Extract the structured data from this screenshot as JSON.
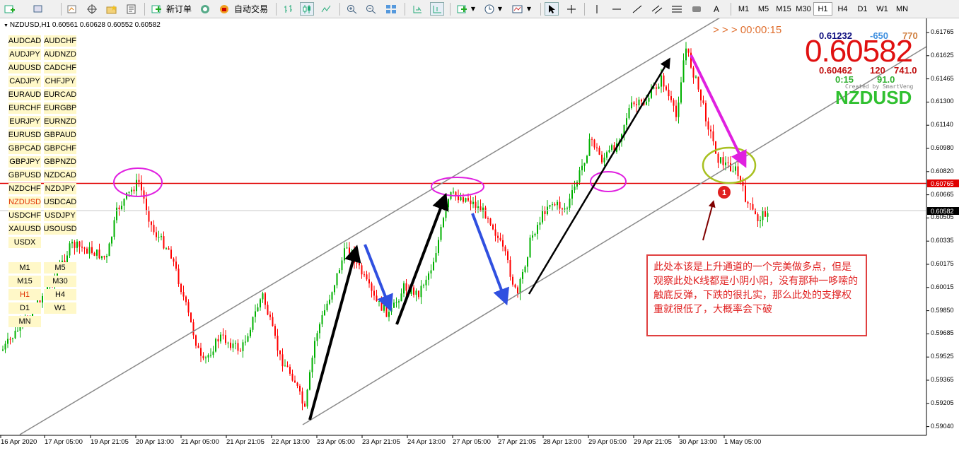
{
  "toolbar": {
    "new_order_label": "新订单",
    "auto_trade_label": "自动交易",
    "timeframes": [
      "M1",
      "M5",
      "M15",
      "M30",
      "H1",
      "H4",
      "D1",
      "W1",
      "MN"
    ],
    "active_timeframe": "H1",
    "text_tool_label": "A"
  },
  "chart": {
    "info_line": "NZDUSD,H1  0.60561 0.60628 0.60552 0.60582",
    "symbol_buttons": [
      "AUDCAD",
      "AUDCHF",
      "AUDJPY",
      "AUDNZD",
      "AUDUSD",
      "CADCHF",
      "CADJPY",
      "CHFJPY",
      "EURAUD",
      "EURCAD",
      "EURCHF",
      "EURGBP",
      "EURJPY",
      "EURNZD",
      "EURUSD",
      "GBPAUD",
      "GBPCAD",
      "GBPCHF",
      "GBPJPY",
      "GBPNZD",
      "GBPUSD",
      "NZDCAD",
      "NZDCHF",
      "NZDJPY",
      "NZDUSD",
      "USDCAD",
      "USDCHF",
      "USDJPY",
      "XAUUSD",
      "USOUSD",
      "USDX"
    ],
    "active_symbol": "NZDUSD",
    "tf_buttons": [
      "M1",
      "M5",
      "M15",
      "M30",
      "H1",
      "H4",
      "D1",
      "W1",
      "MN"
    ],
    "active_tf_button": "H1",
    "panel": {
      "timer": "> > >  00:00:15",
      "high": "0.61232",
      "high_diff": "-650",
      "high_pts": "770",
      "big_price": "0.60582",
      "low": "0.60462",
      "low_diff": "120",
      "low_pts": "741.0",
      "time_left": "0:15",
      "percent": "91.0",
      "creator": "Created by SmartVeng",
      "symbol": "NZDUSD"
    },
    "annotation_text": "此处本该是上升通道的一个完美做多点，但是观察此处K线都是小阴小阳，没有那种一哆嗦的触底反弹，下跌的很扎实，那么此处的支撑权重就很低了，大概率会下破",
    "marker_label": "1",
    "horizontal_line_price": "0.60765",
    "current_price": "0.60582",
    "y_axis_labels": [
      "0.61765",
      "0.61625",
      "0.61465",
      "0.61300",
      "0.61140",
      "0.60980",
      "0.60820",
      "0.60665",
      "0.60505",
      "0.60335",
      "0.60175",
      "0.60015",
      "0.59850",
      "0.59685",
      "0.59525",
      "0.59365",
      "0.59205",
      "0.59040"
    ],
    "x_axis_labels": [
      "16 Apr 2020",
      "17 Apr 05:00",
      "19 Apr 21:05",
      "20 Apr 13:00",
      "21 Apr 05:00",
      "21 Apr 21:05",
      "22 Apr 13:00",
      "23 Apr 05:00",
      "23 Apr 21:05",
      "24 Apr 13:00",
      "27 Apr 05:00",
      "27 Apr 21:05",
      "28 Apr 13:00",
      "29 Apr 05:00",
      "29 Apr 21:05",
      "30 Apr 13:00",
      "1 May 05:00"
    ],
    "colors": {
      "bull": "#00b000",
      "bear": "#ff0000",
      "hline": "#e00000",
      "channel": "#909090",
      "circle_magenta": "#e020e0",
      "circle_olive": "#a8c020"
    }
  }
}
